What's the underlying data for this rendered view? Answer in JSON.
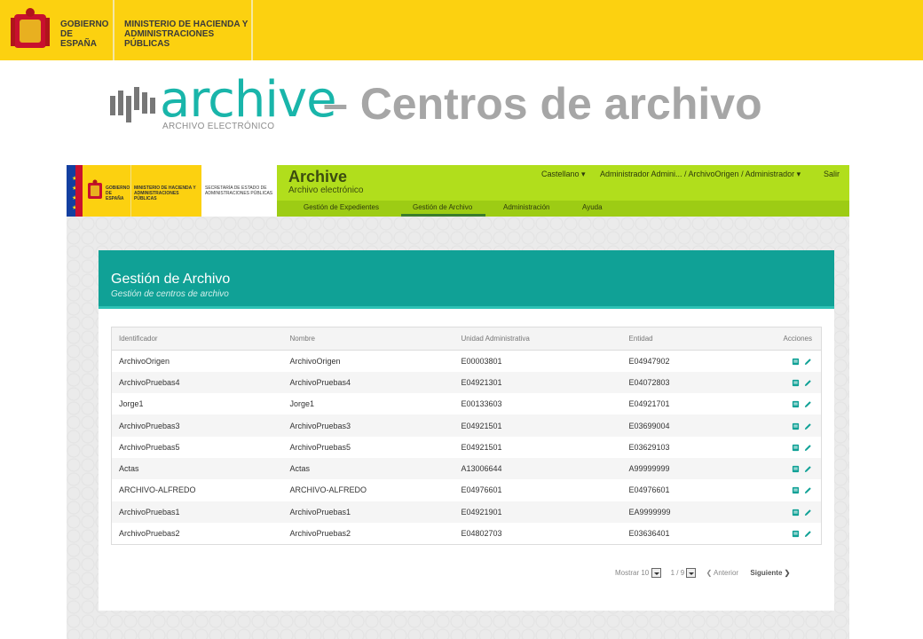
{
  "gov_banner": {
    "gov_label": "GOBIERNO DE ESPAÑA",
    "ministry_label": "MINISTERIO DE HACIENDA Y ADMINISTRACIONES PÚBLICAS"
  },
  "slide": {
    "logo_word": "archive",
    "logo_sub": "ARCHIVO ELECTRÓNICO",
    "heading": "– Centros de archivo"
  },
  "app": {
    "gov_label": "GOBIERNO DE ESPAÑA",
    "ministry_label": "MINISTERIO DE HACIENDA Y ADMINISTRACIONES PÚBLICAS",
    "secretary_label": "SECRETARÍA DE ESTADO DE ADMINISTRACIONES PÚBLICAS",
    "name": "Archive",
    "subtitle": "Archivo electrónico",
    "language": "Castellano ▾",
    "user": "Administrador Admini... / ArchivoOrigen / Administrador ▾",
    "exit": "Salir",
    "nav": [
      "Gestión de Expedientes",
      "Gestión de Archivo",
      "Administración",
      "Ayuda"
    ],
    "active_nav": "Gestión de Archivo",
    "colors": {
      "accent": "#b1de1c",
      "panel": "#10a196",
      "icon": "#10a196"
    }
  },
  "panel": {
    "title": "Gestión de Archivo",
    "subtitle": "Gestión de centros de archivo"
  },
  "table": {
    "headers": [
      "Identificador",
      "Nombre",
      "Unidad Administrativa",
      "Entidad",
      "Acciones"
    ],
    "rows": [
      [
        "ArchivoOrigen",
        "ArchivoOrigen",
        "E00003801",
        "E04947902"
      ],
      [
        "ArchivoPruebas4",
        "ArchivoPruebas4",
        "E04921301",
        "E04072803"
      ],
      [
        "Jorge1",
        "Jorge1",
        "E00133603",
        "E04921701"
      ],
      [
        "ArchivoPruebas3",
        "ArchivoPruebas3",
        "E04921501",
        "E03699004"
      ],
      [
        "ArchivoPruebas5",
        "ArchivoPruebas5",
        "E04921501",
        "E03629103"
      ],
      [
        "Actas",
        "Actas",
        "A13006644",
        "A99999999"
      ],
      [
        "ARCHIVO-ALFREDO",
        "ARCHIVO-ALFREDO",
        "E04976601",
        "E04976601"
      ],
      [
        "ArchivoPruebas1",
        "ArchivoPruebas1",
        "E04921901",
        "EA9999999"
      ],
      [
        "ArchivoPruebas2",
        "ArchivoPruebas2",
        "E04802703",
        "E03636401"
      ]
    ],
    "action_icons": [
      "view-icon",
      "edit-icon"
    ]
  },
  "pager": {
    "show_label": "Mostrar",
    "page_size": "10",
    "page": "1 / 9",
    "prev": "❮ Anterior",
    "next": "Siguiente ❯"
  }
}
